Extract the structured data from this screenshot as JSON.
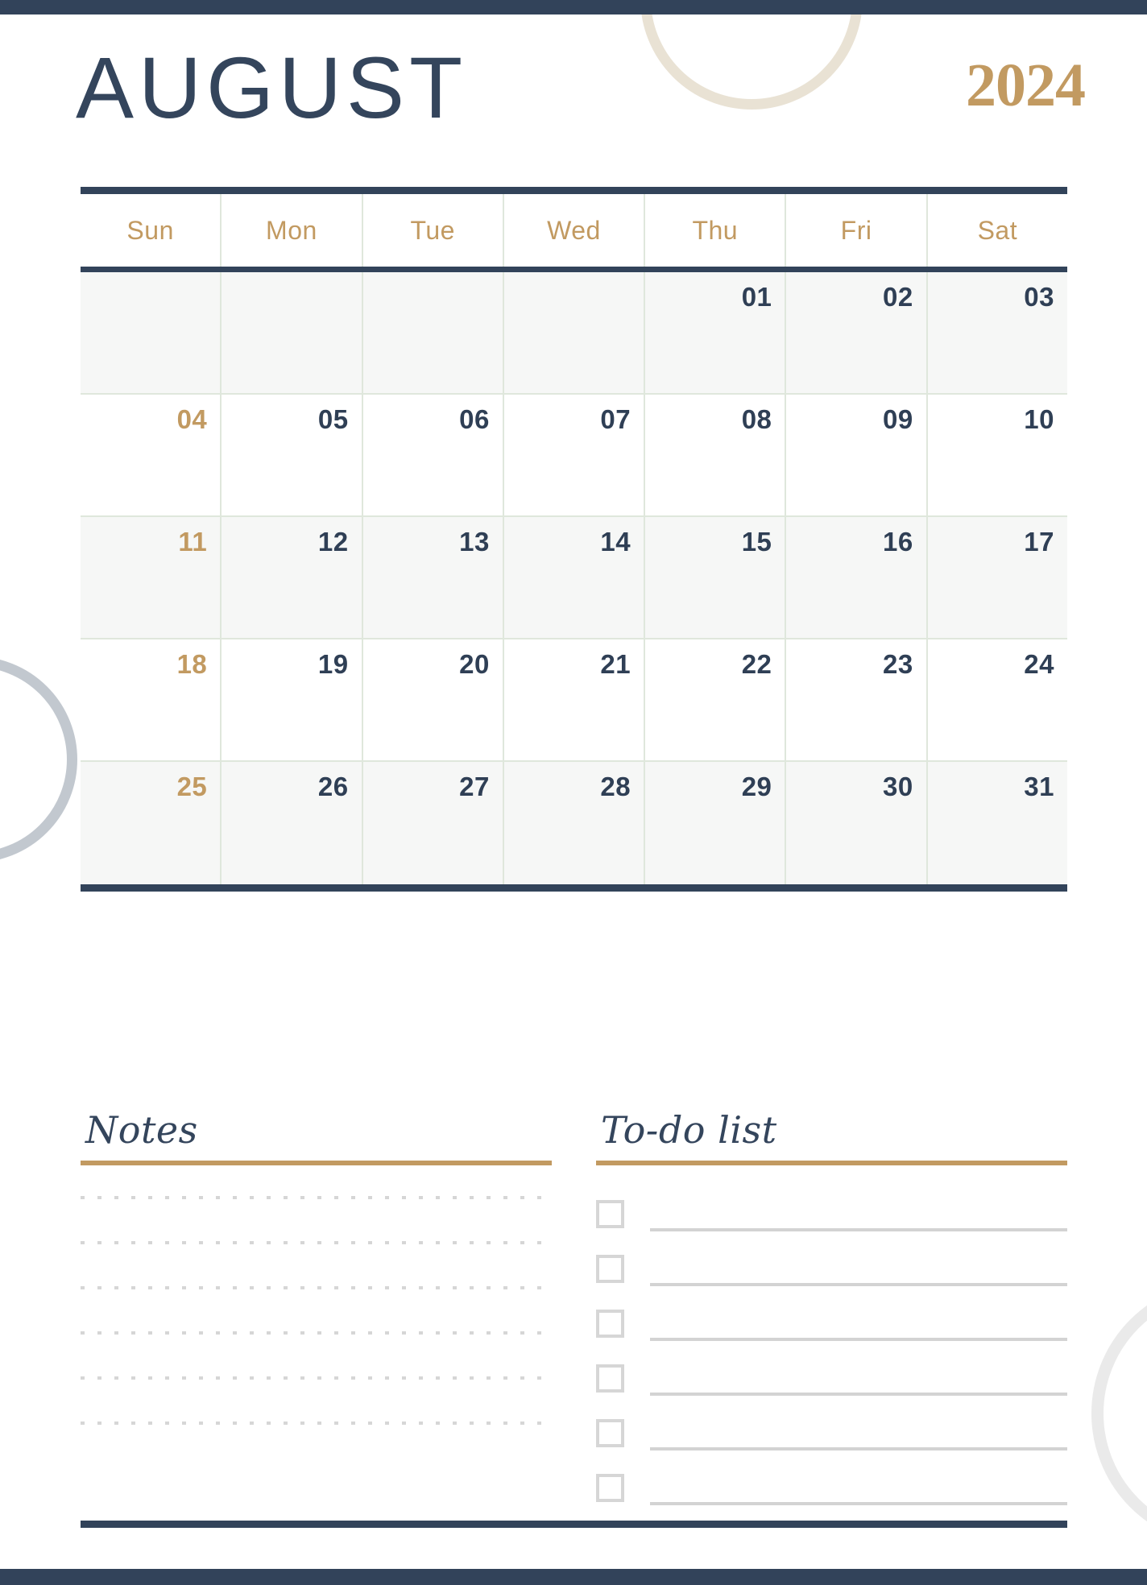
{
  "page": {
    "month": "AUGUST",
    "year": "2024"
  },
  "colors": {
    "navy": "#32435a",
    "gold": "#c29a61",
    "grid_line": "#dfe7dc",
    "shaded_row": "#f6f7f6",
    "note_dot": "#d6d6d6",
    "deco_cream": "#e9e2d4",
    "deco_blue_gray": "#c2c8cf",
    "deco_light_gray": "#eaeaea"
  },
  "calendar": {
    "weekdays": [
      "Sun",
      "Mon",
      "Tue",
      "Wed",
      "Thu",
      "Fri",
      "Sat"
    ],
    "weeks": [
      [
        "",
        "",
        "",
        "",
        "01",
        "02",
        "03"
      ],
      [
        "04",
        "05",
        "06",
        "07",
        "08",
        "09",
        "10"
      ],
      [
        "11",
        "12",
        "13",
        "14",
        "15",
        "16",
        "17"
      ],
      [
        "18",
        "19",
        "20",
        "21",
        "22",
        "23",
        "24"
      ],
      [
        "25",
        "26",
        "27",
        "28",
        "29",
        "30",
        "31"
      ]
    ]
  },
  "notes": {
    "title": "Notes",
    "line_count": 6
  },
  "todo": {
    "title": "To-do list",
    "item_count": 6,
    "items": [
      "",
      "",
      "",
      "",
      "",
      ""
    ]
  }
}
